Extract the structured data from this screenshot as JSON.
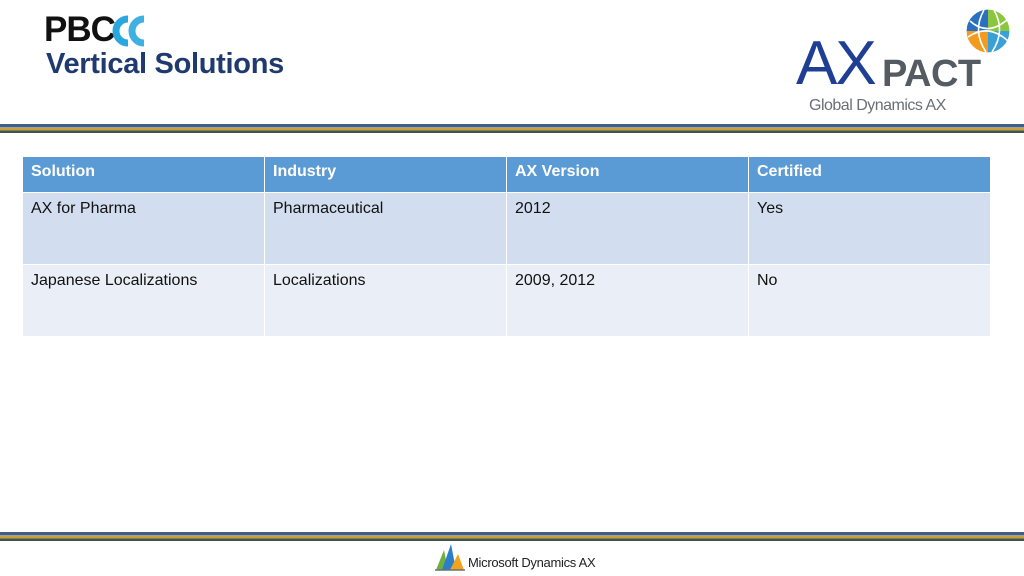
{
  "header": {
    "logo_text": "PBC",
    "title": "Vertical Solutions"
  },
  "brand": {
    "ax_text": "AX",
    "pact_text": "PACT",
    "tagline": "Global Dynamics AX"
  },
  "table": {
    "headers": [
      "Solution",
      "Industry",
      "AX Version",
      "Certified"
    ],
    "rows": [
      [
        "AX for Pharma",
        "Pharmaceutical",
        "2012",
        "Yes"
      ],
      [
        "Japanese Localizations",
        "Localizations",
        "2009, 2012",
        "No"
      ]
    ]
  },
  "footer": {
    "product_text": "Microsoft Dynamics AX"
  },
  "colors": {
    "title": "#1f3a6e",
    "table_header": "#5b9bd5",
    "row_odd": "#d2deef",
    "row_even": "#eaeff7",
    "ax_blue": "#1f3f94",
    "pact_gray": "#555b63",
    "pbc_cyan": "#29a8df"
  },
  "icons": {
    "pbc_logo": "pbc-logo",
    "globe": "globe-icon",
    "footer": "dynamics-ax-logo-icon"
  }
}
